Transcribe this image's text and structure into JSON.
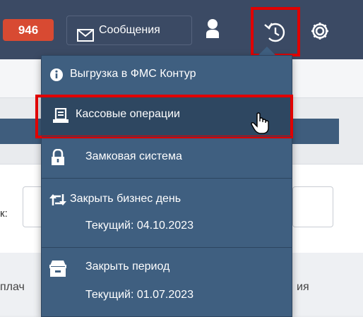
{
  "topbar": {
    "badge_count": "946",
    "messages_label": "Сообщения",
    "icons": [
      "envelope-icon",
      "user-icon",
      "history-icon",
      "gear-icon"
    ]
  },
  "background": {
    "left_fragment": "к:",
    "bottom_left_fragment": "плач",
    "bottom_right_fragment": "ия"
  },
  "menu": {
    "items": [
      {
        "label": "Выгрузка в ФМС Контур",
        "icon": "info-icon"
      },
      {
        "label": "Кассовые операции",
        "icon": "cash-register-icon",
        "active": true
      },
      {
        "label": "Замковая система",
        "icon": "lock-icon"
      },
      {
        "label": "Закрыть бизнес день",
        "sub": "Текущий: 04.10.2023",
        "icon": "retweet-icon"
      },
      {
        "label": "Закрыть период",
        "sub": "Текущий: 01.07.2023",
        "icon": "archive-icon"
      }
    ]
  },
  "colors": {
    "navbar": "#3b4a64",
    "menu_bg": "#3f5f80",
    "badge": "#d84a32",
    "highlight": "#e00000"
  }
}
